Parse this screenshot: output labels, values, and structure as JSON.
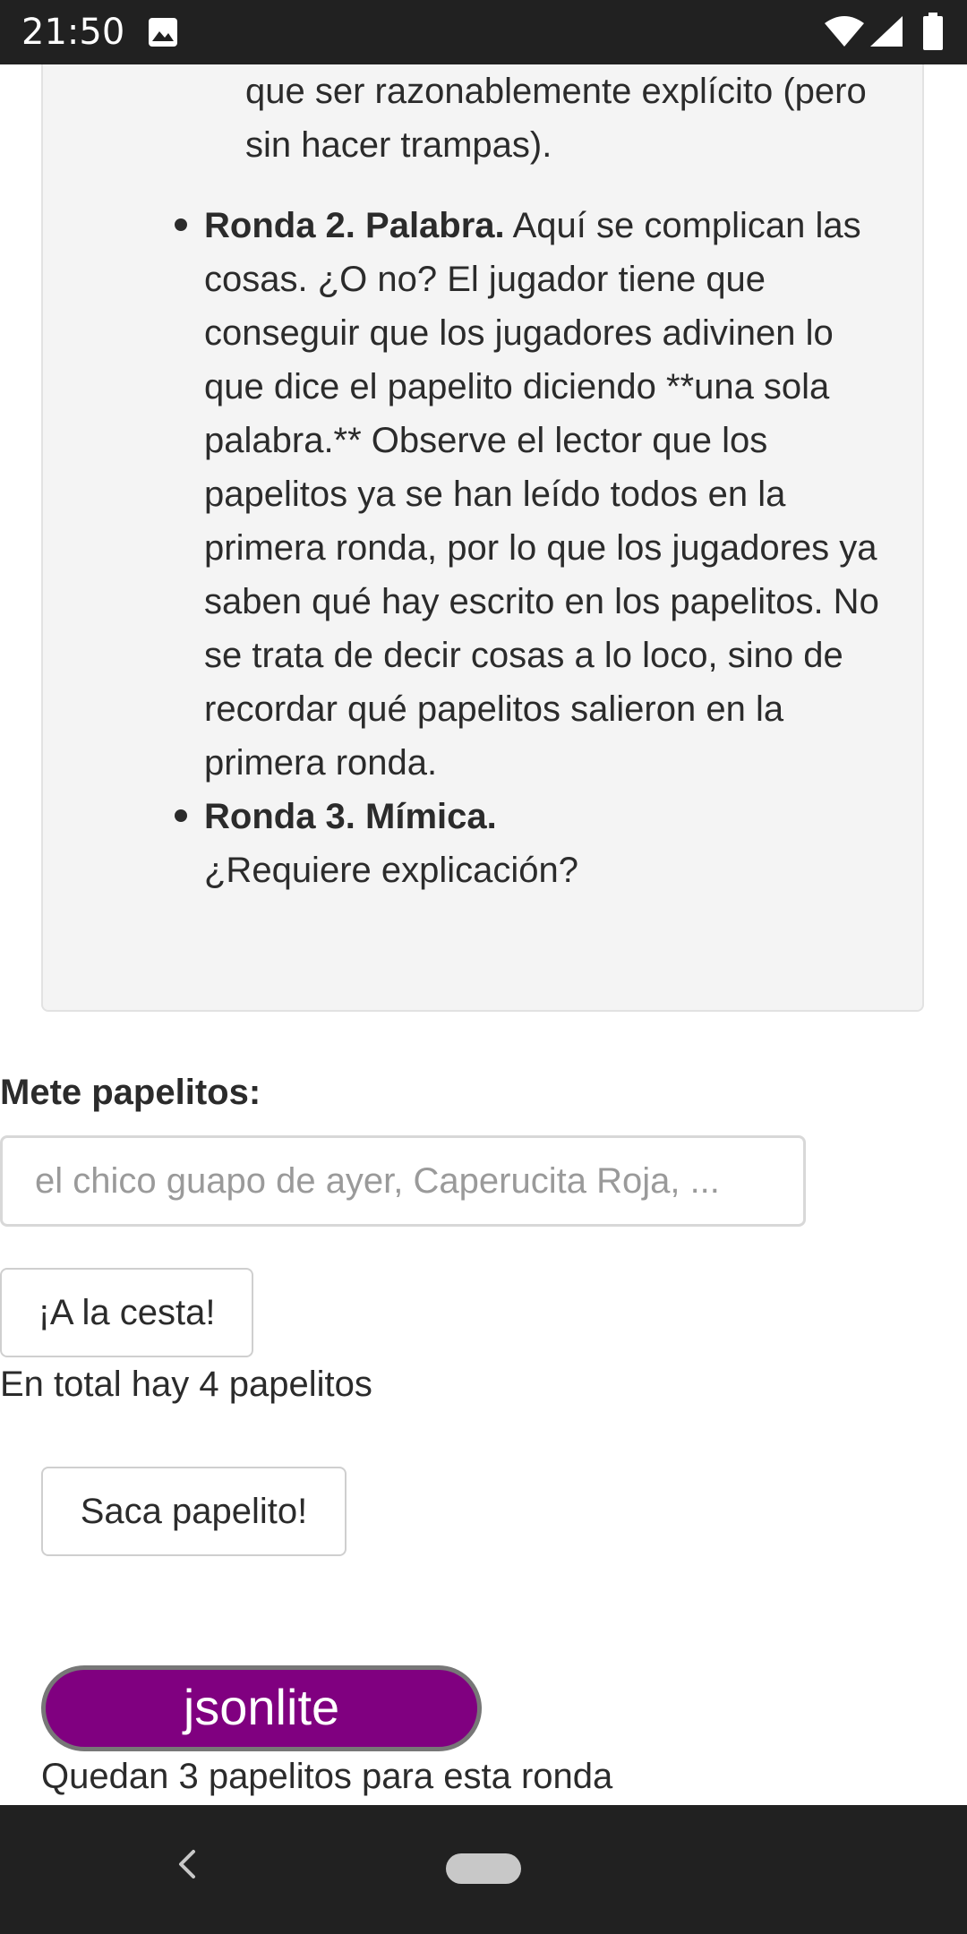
{
  "status_bar": {
    "time": "21:50",
    "icons": [
      "image-icon",
      "wifi-icon",
      "signal-icon",
      "battery-icon"
    ]
  },
  "rules": {
    "intro_text": "escrito en los papelitos, así que habrá que ser razonablemente explícito (pero sin hacer trampas).",
    "items": [
      {
        "title": "Ronda 2. Palabra.",
        "text": "Aquí se complican las cosas. ¿O no? El jugador tiene que conseguir que los jugadores adivinen lo que dice el papelito diciendo **una sola palabra.** Observe el lector que los papelitos ya se han leído todos en la primera ronda, por lo que los jugadores ya saben qué hay escrito en los papelitos. No se trata de decir cosas a lo loco, sino de recordar qué papelitos salieron en la primera ronda."
      },
      {
        "title": "Ronda 3. Mímica.",
        "text": "¿Requiere explicación?"
      }
    ]
  },
  "form": {
    "label": "Mete papelitos:",
    "input_placeholder": "el chico guapo de ayer, Caperucita Roja, ...",
    "input_value": "",
    "add_button": "¡A la cesta!"
  },
  "total_text": "En total hay 4 papelitos",
  "draw_button": "Saca papelito!",
  "current_player": "jsonlite",
  "remaining_text": "Quedan 3 papelitos para esta ronda",
  "colors": {
    "status_bar_bg": "#212121",
    "rules_box_bg": "#f4f4f4",
    "pill_bg": "#800080",
    "pill_border": "#777777"
  }
}
